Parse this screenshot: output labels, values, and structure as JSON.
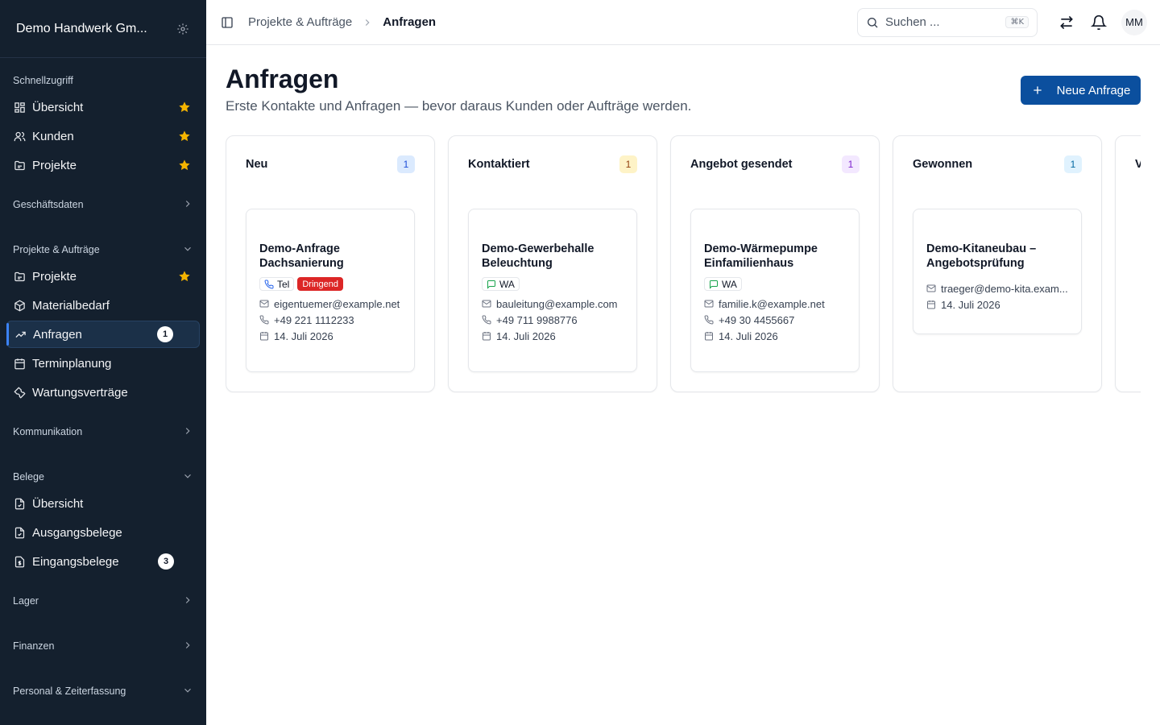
{
  "sidebar": {
    "company": "Demo Handwerk Gm...",
    "sections": [
      {
        "title": "Schnellzugriff",
        "collapsible": false,
        "items": [
          {
            "label": "Übersicht",
            "icon": "grid-icon",
            "star": true
          },
          {
            "label": "Kunden",
            "icon": "users-icon",
            "star": true
          },
          {
            "label": "Projekte",
            "icon": "folder-icon",
            "star": true
          }
        ]
      },
      {
        "title": "Geschäftsdaten",
        "chevron": "right",
        "items": []
      },
      {
        "title": "Projekte & Aufträge",
        "chevron": "down",
        "items": [
          {
            "label": "Projekte",
            "icon": "folder-icon",
            "star": true
          },
          {
            "label": "Materialbedarf",
            "icon": "package-icon"
          },
          {
            "label": "Anfragen",
            "icon": "trending-up-icon",
            "badge": "1",
            "active": true
          },
          {
            "label": "Terminplanung",
            "icon": "calendar-icon"
          },
          {
            "label": "Wartungsverträge",
            "icon": "wrench-icon"
          }
        ]
      },
      {
        "title": "Kommunikation",
        "chevron": "right",
        "items": []
      },
      {
        "title": "Belege",
        "chevron": "down",
        "items": [
          {
            "label": "Übersicht",
            "icon": "file-check-icon"
          },
          {
            "label": "Ausgangsbelege",
            "icon": "file-check-icon"
          },
          {
            "label": "Eingangsbelege",
            "icon": "file-dollar-icon",
            "badge": "3"
          }
        ]
      },
      {
        "title": "Lager",
        "chevron": "right",
        "items": []
      },
      {
        "title": "Finanzen",
        "chevron": "right",
        "items": []
      },
      {
        "title": "Personal & Zeiterfassung",
        "chevron": "down",
        "items": []
      }
    ]
  },
  "topbar": {
    "breadcrumb_parent": "Projekte & Aufträge",
    "breadcrumb_current": "Anfragen",
    "search_placeholder": "Suchen ...",
    "search_shortcut": "⌘K",
    "avatar_initials": "MM"
  },
  "page": {
    "title": "Anfragen",
    "subtitle": "Erste Kontakte und Anfragen — bevor daraus Kunden oder Aufträge werden.",
    "new_button": "Neue Anfrage"
  },
  "colors": {
    "sidebar_bg": "#14202e",
    "primary": "#0b4f9e",
    "star": "#f5b400",
    "urgent": "#dc2626"
  },
  "columns": [
    {
      "title": "Neu",
      "count": "1",
      "count_bg": "#dbeafe",
      "count_fg": "#1d4ed8",
      "cards": [
        {
          "title_lines": [
            "Demo-Anfrage",
            "Dachsanierung"
          ],
          "tags": [
            {
              "label": "Tel",
              "icon": "phone-icon"
            },
            {
              "label": "Dringend",
              "urgent": true
            }
          ],
          "email": "eigentuemer@example.net",
          "phone": "+49 221 1112233",
          "date": "14. Juli 2026"
        }
      ]
    },
    {
      "title": "Kontaktiert",
      "count": "1",
      "count_bg": "#fef3c7",
      "count_fg": "#92400e",
      "cards": [
        {
          "title_lines": [
            "Demo-Gewerbehalle",
            "Beleuchtung"
          ],
          "tags": [
            {
              "label": "WA",
              "icon": "message-icon"
            }
          ],
          "email": "bauleitung@example.com",
          "phone": "+49 711 9988776",
          "date": "14. Juli 2026"
        }
      ]
    },
    {
      "title": "Angebot gesendet",
      "count": "1",
      "count_bg": "#f3e8ff",
      "count_fg": "#7e22ce",
      "cards": [
        {
          "title_lines": [
            "Demo-Wärmepumpe",
            "Einfamilienhaus"
          ],
          "tags": [
            {
              "label": "WA",
              "icon": "message-icon"
            }
          ],
          "email": "familie.k@example.net",
          "phone": "+49 30 4455667",
          "date": "14. Juli 2026"
        }
      ]
    },
    {
      "title": "Gewonnen",
      "count": "1",
      "count_bg": "#e0f2fe",
      "count_fg": "#0369a1",
      "cards": [
        {
          "title_lines": [
            "Demo-Kitaneubau –",
            "Angebotsprüfung"
          ],
          "tags": [],
          "email": "traeger@demo-kita.exam...",
          "phone": "",
          "date": "14. Juli 2026"
        }
      ]
    },
    {
      "title": "V",
      "count": "",
      "cards": []
    }
  ]
}
